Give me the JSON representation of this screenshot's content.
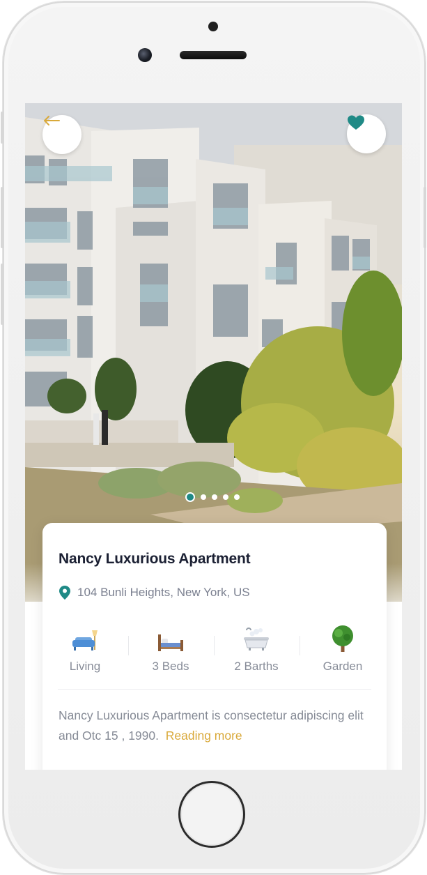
{
  "property": {
    "title": "Nancy Luxurious Apartment",
    "location": "104 Bunli Heights, New York, US",
    "description": "Nancy Luxurious Apartment is consectetur adipiscing elit and Otc 15 , 1990.",
    "read_more": "Reading more"
  },
  "amenities": [
    {
      "label": "Living",
      "icon": "sofa-icon"
    },
    {
      "label": "3 Beds",
      "icon": "bed-icon"
    },
    {
      "label": "2 Barths",
      "icon": "bathtub-icon"
    },
    {
      "label": "Garden",
      "icon": "tree-icon"
    }
  ],
  "gallery": {
    "total_slides": 5,
    "active_slide": 1
  },
  "colors": {
    "accent": "#1f8a86",
    "link": "#d9a93a",
    "back_arrow": "#d9a93a",
    "text_dark": "#1b2033"
  }
}
